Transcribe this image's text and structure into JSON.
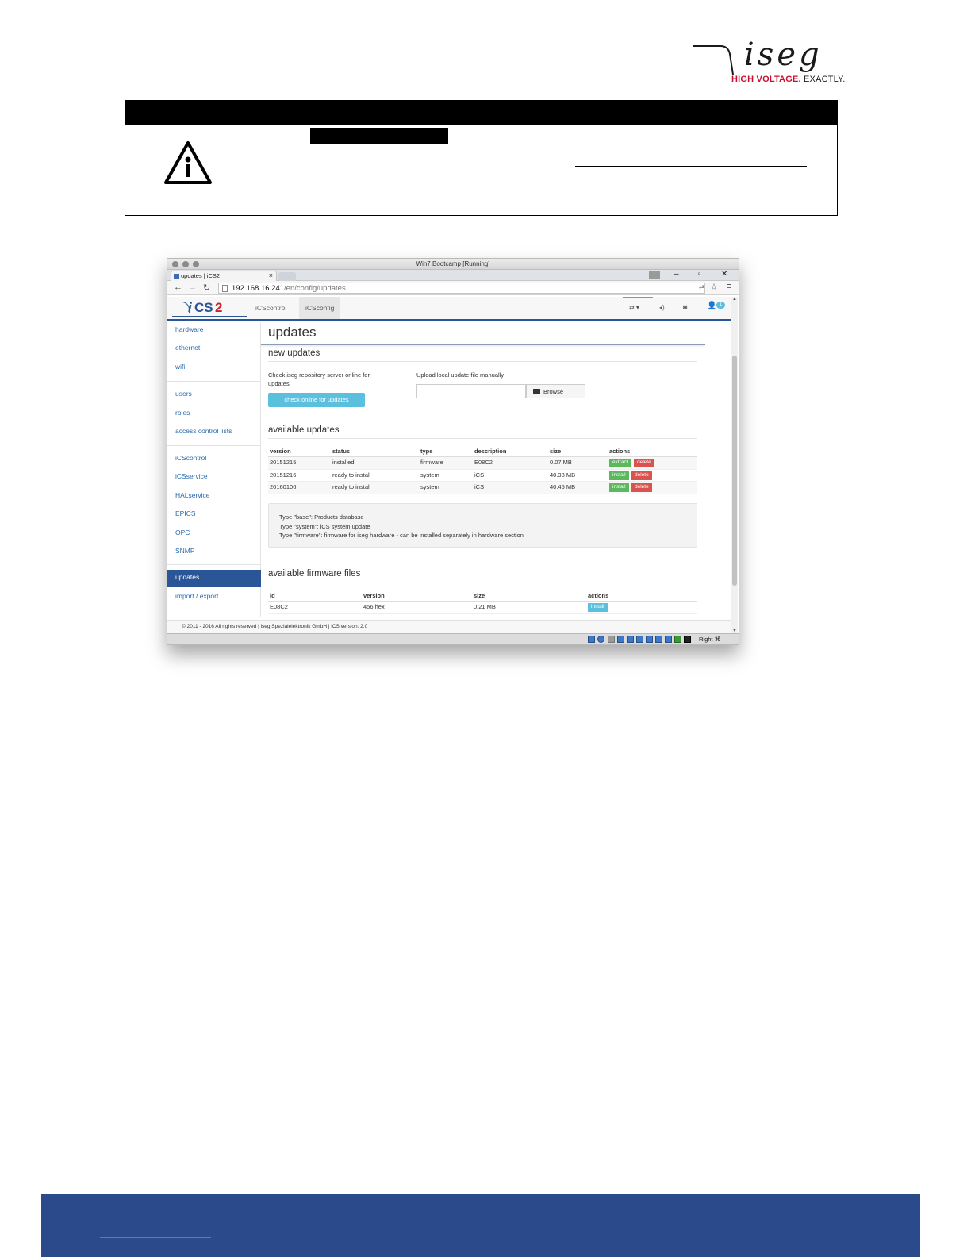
{
  "logo": {
    "word": "iseg",
    "tagline_red": "HIGH VOLTAGE.",
    "tagline_black": " EXACTLY."
  },
  "vm": {
    "window_title": "Win7 Bootcamp [Running]",
    "browser": {
      "tab_title": "updates | iCS2",
      "tab_close": "×",
      "url_host": "192.168.16.241",
      "url_path": "/en/config/updates",
      "win_min": "–",
      "win_restore": "▫",
      "win_close": "✕"
    },
    "app": {
      "logo_i": "i",
      "logo_cs": "CS",
      "logo_2": "2",
      "nav_tabs": [
        "iCScontrol",
        "iCSconfig"
      ],
      "notification_count": "1"
    },
    "sidebar": {
      "group1": [
        "hardware",
        "ethernet",
        "wifi"
      ],
      "group2": [
        "users",
        "roles",
        "access control lists"
      ],
      "group3": [
        "iCScontrol",
        "iCSservice",
        "HALservice",
        "EPICS",
        "OPC",
        "SNMP"
      ],
      "group4": [
        "updates",
        "import / export"
      ]
    },
    "content": {
      "page_title": "updates",
      "new_updates_heading": "new updates",
      "online_text_line1": "Check iseg repository server online for",
      "online_text_line2": "updates",
      "check_button": "check online for updates",
      "upload_text": "Upload local update file manually",
      "browse_button": "Browse",
      "available_updates_heading": "available updates",
      "updates_table": {
        "headers": [
          "version",
          "status",
          "type",
          "description",
          "size",
          "actions"
        ],
        "rows": [
          {
            "version": "20151215",
            "status": "installed",
            "type": "firmware",
            "description": "E08C2",
            "size": "0.07 MB",
            "action1": "extract",
            "action2": "delete"
          },
          {
            "version": "20151216",
            "status": "ready to install",
            "type": "system",
            "description": "iCS",
            "size": "40.38 MB",
            "action1": "install",
            "action2": "delete"
          },
          {
            "version": "20160106",
            "status": "ready to install",
            "type": "system",
            "description": "iCS",
            "size": "40.45 MB",
            "action1": "install",
            "action2": "delete"
          }
        ]
      },
      "info_lines": [
        "Type \"base\": Products database",
        "Type \"system\": iCS system update",
        "Type \"firmware\": firmware for iseg hardware - can be installed separately in hardware section"
      ],
      "firmware_heading": "available firmware files",
      "firmware_table": {
        "headers": [
          "id",
          "version",
          "size",
          "actions"
        ],
        "rows": [
          {
            "id": "E08C2",
            "version": "456.hex",
            "size": "0.21 MB",
            "action": "install"
          }
        ]
      },
      "footer": "© 2011 - 2016 All rights reserved | iseg Spezialelektronik GmbH | iCS version: 2.0"
    },
    "statusbar_text": "Right ⌘"
  }
}
